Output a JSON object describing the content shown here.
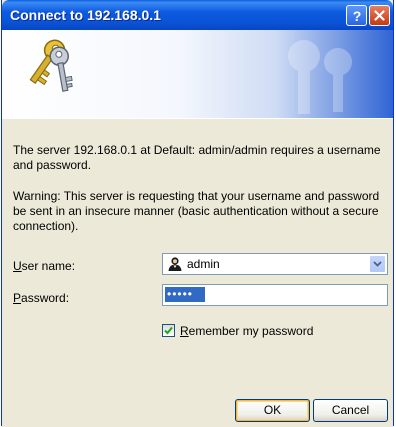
{
  "dialog": {
    "title": "Connect to 192.168.0.1",
    "message": "The server 192.168.0.1 at Default: admin/admin requires a username and password.",
    "warning": "Warning: This server is requesting that your username and password be sent in an insecure manner (basic authentication without a secure connection).",
    "username_label_key": "U",
    "username_label_rest": "ser name:",
    "username_value": "admin",
    "password_label_key": "P",
    "password_label_rest": "assword:",
    "password_value": "•••••",
    "remember_label_key": "R",
    "remember_label_rest": "emember my password",
    "remember_checked": true,
    "ok_label": "OK",
    "cancel_label": "Cancel"
  },
  "icons": {
    "help": "help-icon",
    "close": "close-icon",
    "keys": "keys-icon",
    "user": "user-icon",
    "dropdown": "chevron-down-icon",
    "checkmark": "checkmark-icon"
  },
  "colors": {
    "titlebar": "#0a53d6",
    "face": "#ece9d8",
    "selection": "#316ac5",
    "close_button": "#c43a14"
  }
}
